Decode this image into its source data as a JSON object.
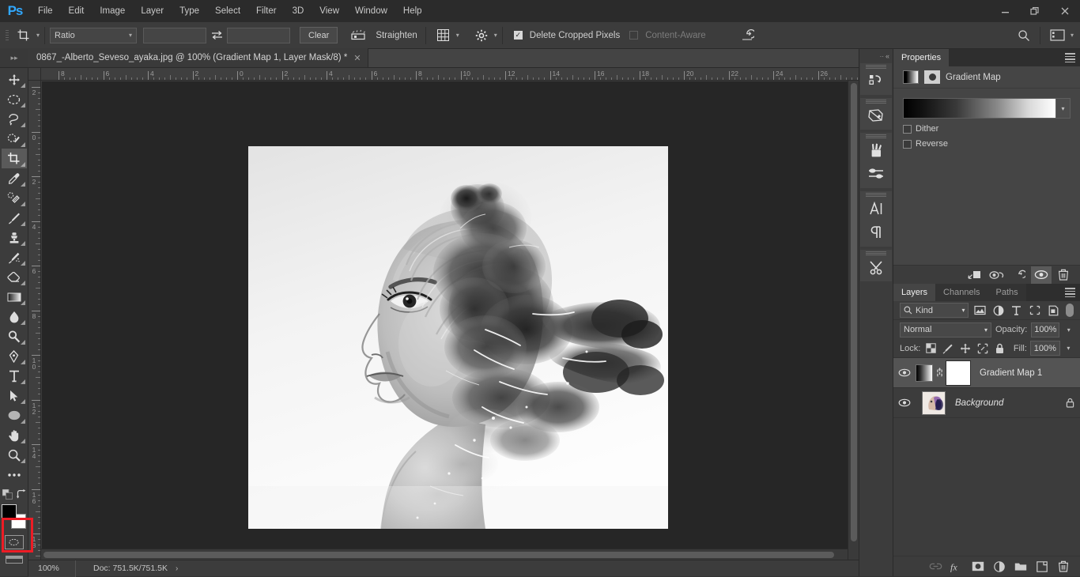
{
  "app": {
    "logo": "Ps"
  },
  "menubar": {
    "items": [
      {
        "label": "File"
      },
      {
        "label": "Edit"
      },
      {
        "label": "Image"
      },
      {
        "label": "Layer"
      },
      {
        "label": "Type"
      },
      {
        "label": "Select"
      },
      {
        "label": "Filter"
      },
      {
        "label": "3D"
      },
      {
        "label": "View"
      },
      {
        "label": "Window"
      },
      {
        "label": "Help"
      }
    ],
    "window_controls": {
      "minimize": "—",
      "restore": "❐",
      "close": "✕"
    }
  },
  "options_bar": {
    "tool_icon": "crop-tool-icon",
    "ratio_select": "Ratio",
    "width_value": "",
    "height_value": "",
    "swap_icon": "swap-arrows-icon",
    "clear_label": "Clear",
    "straighten_icon": "straighten-icon",
    "straighten_label": "Straighten",
    "overlay_icon": "grid-overlay-icon",
    "settings_icon": "gear-icon",
    "delete_cropped_label": "Delete Cropped Pixels",
    "delete_cropped_checked": true,
    "content_aware_label": "Content-Aware",
    "content_aware_checked": false,
    "reset_icon": "reset-arrow-icon",
    "search_icon": "search-icon",
    "workspace_icon": "workspace-switcher-icon"
  },
  "document_tab": {
    "title": "0867_-Alberto_Seveso_ayaka.jpg @ 100% (Gradient Map 1, Layer Mask/8) *",
    "close": "✕"
  },
  "toolbar": {
    "tools": [
      {
        "name": "move-tool",
        "label": "Move Tool"
      },
      {
        "name": "marquee-tool",
        "label": "Rectangular Marquee Tool"
      },
      {
        "name": "lasso-tool",
        "label": "Lasso Tool"
      },
      {
        "name": "quick-selection-tool",
        "label": "Quick Selection Tool"
      },
      {
        "name": "crop-tool",
        "label": "Crop Tool",
        "active": true
      },
      {
        "name": "eyedropper-tool",
        "label": "Eyedropper Tool"
      },
      {
        "name": "healing-brush-tool",
        "label": "Spot Healing Brush Tool"
      },
      {
        "name": "brush-tool",
        "label": "Brush Tool"
      },
      {
        "name": "clone-stamp-tool",
        "label": "Clone Stamp Tool"
      },
      {
        "name": "history-brush-tool",
        "label": "History Brush Tool"
      },
      {
        "name": "eraser-tool",
        "label": "Eraser Tool"
      },
      {
        "name": "gradient-tool",
        "label": "Gradient Tool"
      },
      {
        "name": "blur-tool",
        "label": "Blur Tool"
      },
      {
        "name": "dodge-tool",
        "label": "Dodge Tool"
      },
      {
        "name": "pen-tool",
        "label": "Pen Tool"
      },
      {
        "name": "type-tool",
        "label": "Horizontal Type Tool"
      },
      {
        "name": "path-selection-tool",
        "label": "Path Selection Tool"
      },
      {
        "name": "ellipse-tool",
        "label": "Ellipse Tool"
      },
      {
        "name": "hand-tool",
        "label": "Hand Tool"
      },
      {
        "name": "zoom-tool",
        "label": "Zoom Tool"
      },
      {
        "name": "edit-toolbar",
        "label": "Edit Toolbar"
      }
    ],
    "foreground_color": "#000000",
    "background_color": "#ffffff",
    "highlight_color": "#ee1c25"
  },
  "rulers": {
    "horizontal_labels": [
      "8",
      "6",
      "4",
      "2",
      "0",
      "2",
      "4",
      "6",
      "8",
      "10",
      "12",
      "14",
      "16",
      "18",
      "20",
      "22",
      "24",
      "26"
    ],
    "vertical_labels": [
      "2",
      "0",
      "2",
      "4",
      "6",
      "8",
      "10",
      "12",
      "14",
      "16",
      "18"
    ]
  },
  "canvas": {
    "artwork_description": "Black and white double-exposure portrait of a woman in profile with ink dispersing from her hair",
    "background_color": "#262626"
  },
  "status_bar": {
    "zoom": "100%",
    "doc_info": "Doc: 751.5K/751.5K",
    "expand_arrow": "›"
  },
  "icon_dock": {
    "collapse": "«",
    "groups": [
      [
        {
          "name": "history-panel-icon"
        }
      ],
      [
        {
          "name": "adjustments-panel-icon"
        }
      ],
      [
        {
          "name": "brushes-panel-icon"
        },
        {
          "name": "brush-settings-panel-icon"
        }
      ],
      [
        {
          "name": "character-panel-icon"
        },
        {
          "name": "paragraph-panel-icon"
        }
      ],
      [
        {
          "name": "tool-presets-panel-icon"
        }
      ]
    ]
  },
  "properties_panel": {
    "tab_label": "Properties",
    "adjustment_title": "Gradient Map",
    "gradient_preview": "black-to-white",
    "dither_label": "Dither",
    "dither_checked": false,
    "reverse_label": "Reverse",
    "reverse_checked": false,
    "footer_icons": [
      {
        "name": "clip-to-layer-icon"
      },
      {
        "name": "view-previous-state-icon"
      },
      {
        "name": "reset-adjustment-icon"
      },
      {
        "name": "toggle-visibility-icon",
        "active": true
      },
      {
        "name": "delete-adjustment-icon"
      }
    ]
  },
  "layers_panel": {
    "tabs": [
      {
        "label": "Layers",
        "active": true
      },
      {
        "label": "Channels",
        "active": false
      },
      {
        "label": "Paths",
        "active": false
      }
    ],
    "filter": {
      "kind_label": "Kind",
      "icons": [
        {
          "name": "filter-pixel-icon"
        },
        {
          "name": "filter-adjustment-icon"
        },
        {
          "name": "filter-type-icon"
        },
        {
          "name": "filter-shape-icon"
        },
        {
          "name": "filter-smart-object-icon"
        }
      ],
      "toggle_name": "filter-enable-toggle"
    },
    "blend_mode": "Normal",
    "opacity_label": "Opacity:",
    "opacity_value": "100%",
    "lock_label": "Lock:",
    "lock_icons": [
      {
        "name": "lock-transparent-pixels-icon"
      },
      {
        "name": "lock-image-pixels-icon"
      },
      {
        "name": "lock-position-icon"
      },
      {
        "name": "lock-artboard-nesting-icon"
      },
      {
        "name": "lock-all-icon"
      }
    ],
    "fill_label": "Fill:",
    "fill_value": "100%",
    "layers": [
      {
        "name": "Gradient Map 1",
        "type": "adjustment",
        "visible": true,
        "selected": true,
        "linked": true,
        "has_mask": true,
        "locked": false,
        "italic": false
      },
      {
        "name": "Background",
        "type": "image",
        "visible": true,
        "selected": false,
        "linked": false,
        "has_mask": false,
        "locked": true,
        "italic": true
      }
    ],
    "footer_icons": [
      {
        "name": "link-layers-icon",
        "dim": true
      },
      {
        "name": "layer-style-fx-icon",
        "dim": false
      },
      {
        "name": "add-layer-mask-icon",
        "dim": false
      },
      {
        "name": "new-adjustment-layer-icon",
        "dim": false
      },
      {
        "name": "new-group-icon",
        "dim": false
      },
      {
        "name": "new-layer-icon",
        "dim": false
      },
      {
        "name": "delete-layer-icon",
        "dim": false
      }
    ]
  }
}
